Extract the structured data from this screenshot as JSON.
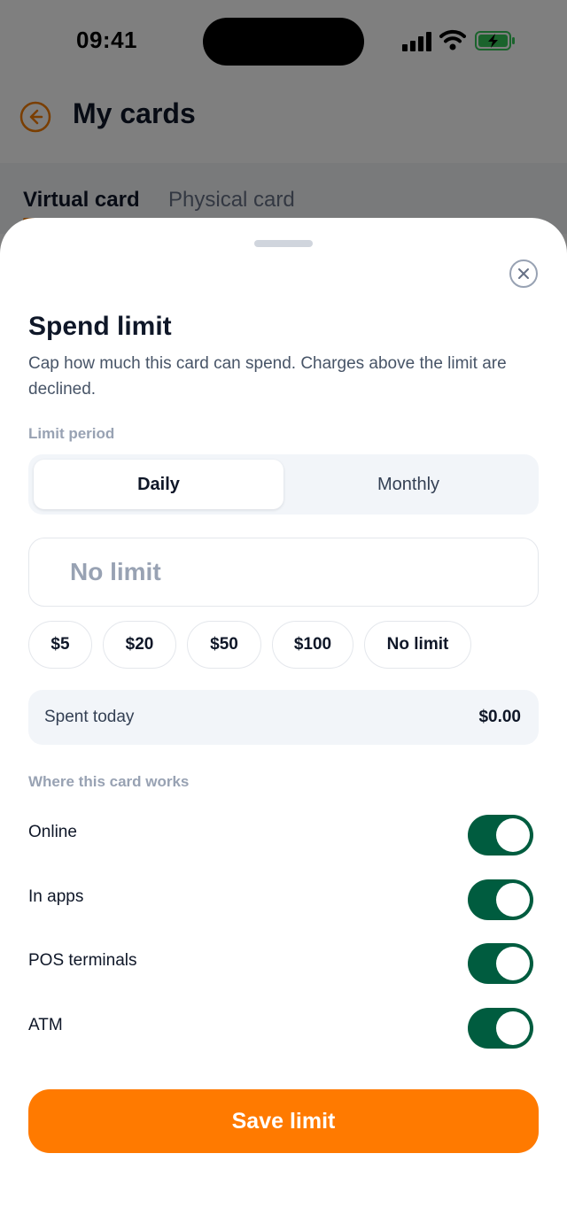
{
  "status_bar": {
    "time": "09:41",
    "icons": [
      "signal-icon",
      "wifi-icon",
      "battery-charging-icon"
    ]
  },
  "header": {
    "title": "My cards",
    "back_icon": "arrow-left-circle-icon"
  },
  "tabs": [
    {
      "label": "Virtual card",
      "active": true
    },
    {
      "label": "Physical card",
      "active": false
    }
  ],
  "sheet": {
    "title": "Spend limit",
    "description": "Cap how much this card can spend. Charges above the limit are declined.",
    "close_icon": "close-icon",
    "limit_period": {
      "label": "Limit period",
      "options": [
        {
          "label": "Daily",
          "selected": true
        },
        {
          "label": "Monthly",
          "selected": false
        }
      ]
    },
    "amount": {
      "placeholder": "No limit",
      "value": ""
    },
    "presets": [
      "$5",
      "$20",
      "$50",
      "$100",
      "No limit"
    ],
    "spent": {
      "label": "Spent today",
      "value": "$0.00"
    },
    "channels": {
      "label": "Where this card works",
      "items": [
        {
          "label": "Online",
          "enabled": true
        },
        {
          "label": "In apps",
          "enabled": true
        },
        {
          "label": "POS terminals",
          "enabled": true
        },
        {
          "label": "ATM",
          "enabled": true
        }
      ]
    },
    "save_label": "Save limit"
  },
  "colors": {
    "accent": "#ff7a00",
    "toggle_on": "#005c3f",
    "back_icon": "#f57c00",
    "battery": "#34c759"
  }
}
